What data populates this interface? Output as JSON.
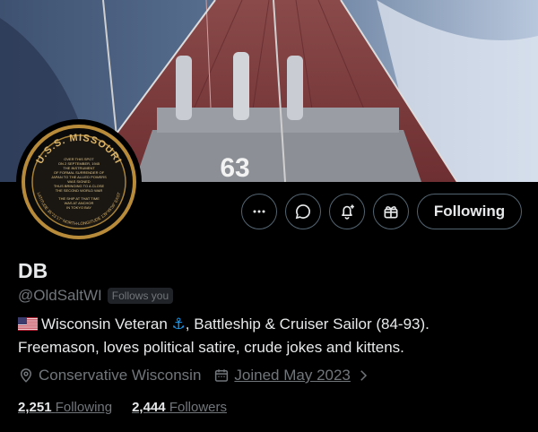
{
  "profile": {
    "banner_number": "63",
    "avatar_text": {
      "ship": "U.S.S. MISSOURI",
      "latitude": "LATITUDE 35°21'17\" NORTH-LONGITUDE 139°45'36\" EAST",
      "plaque": [
        "OVER THIS SPOT",
        "ON 2 SEPTEMBER, 1945",
        "THE INSTRUMENT",
        "OF FORMAL SURRENDER OF",
        "JAPAN TO THE ALLIED POWERS",
        "WAS SIGNED",
        "THUS BRINGING TO A CLOSE",
        "THE SECOND WORLD WAR",
        "THE SHIP AT THAT TIME",
        "WAS AT ANCHOR",
        "IN TOKYO BAY"
      ]
    },
    "name": "DB",
    "handle": "@OldSaltWI",
    "follows_you": "Follows you",
    "bio_line1": "Wisconsin Veteran",
    "bio_anchor": "⚓",
    "bio_line1_rest": ", Battleship & Cruiser Sailor (84-93).",
    "bio_line2": "Freemason, loves political satire, crude jokes and kittens.",
    "location": "Conservative Wisconsin",
    "joined": "Joined May 2023",
    "following_count": "2,251",
    "following_label": "Following",
    "followers_count": "2,444",
    "followers_label": "Followers"
  },
  "actions": {
    "follow_button": "Following",
    "icons": [
      "more-icon",
      "message-icon",
      "notify-icon",
      "subscribe-icon"
    ]
  },
  "colors": {
    "background": "#000000",
    "text": "#e7e9ea",
    "muted": "#71767b",
    "border": "#536471",
    "accent": "#1d9bf0"
  }
}
